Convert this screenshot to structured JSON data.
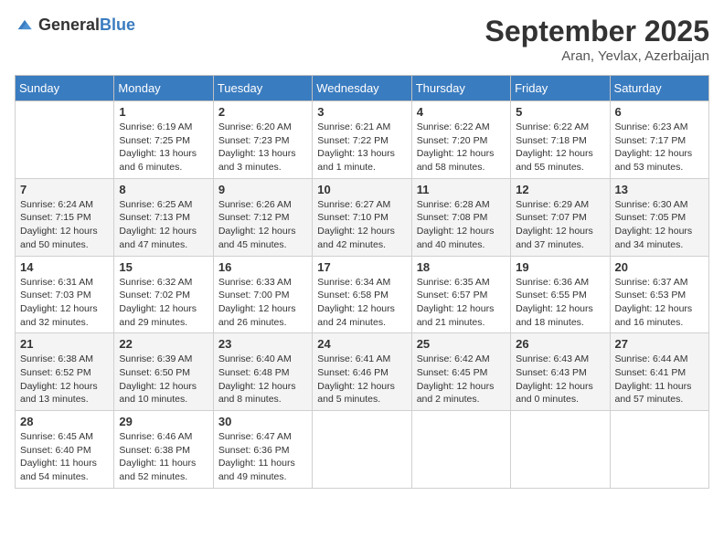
{
  "logo": {
    "general": "General",
    "blue": "Blue"
  },
  "header": {
    "month": "September 2025",
    "location": "Aran, Yevlax, Azerbaijan"
  },
  "weekdays": [
    "Sunday",
    "Monday",
    "Tuesday",
    "Wednesday",
    "Thursday",
    "Friday",
    "Saturday"
  ],
  "weeks": [
    [
      {
        "day": "",
        "text": ""
      },
      {
        "day": "1",
        "text": "Sunrise: 6:19 AM\nSunset: 7:25 PM\nDaylight: 13 hours\nand 6 minutes."
      },
      {
        "day": "2",
        "text": "Sunrise: 6:20 AM\nSunset: 7:23 PM\nDaylight: 13 hours\nand 3 minutes."
      },
      {
        "day": "3",
        "text": "Sunrise: 6:21 AM\nSunset: 7:22 PM\nDaylight: 13 hours\nand 1 minute."
      },
      {
        "day": "4",
        "text": "Sunrise: 6:22 AM\nSunset: 7:20 PM\nDaylight: 12 hours\nand 58 minutes."
      },
      {
        "day": "5",
        "text": "Sunrise: 6:22 AM\nSunset: 7:18 PM\nDaylight: 12 hours\nand 55 minutes."
      },
      {
        "day": "6",
        "text": "Sunrise: 6:23 AM\nSunset: 7:17 PM\nDaylight: 12 hours\nand 53 minutes."
      }
    ],
    [
      {
        "day": "7",
        "text": "Sunrise: 6:24 AM\nSunset: 7:15 PM\nDaylight: 12 hours\nand 50 minutes."
      },
      {
        "day": "8",
        "text": "Sunrise: 6:25 AM\nSunset: 7:13 PM\nDaylight: 12 hours\nand 47 minutes."
      },
      {
        "day": "9",
        "text": "Sunrise: 6:26 AM\nSunset: 7:12 PM\nDaylight: 12 hours\nand 45 minutes."
      },
      {
        "day": "10",
        "text": "Sunrise: 6:27 AM\nSunset: 7:10 PM\nDaylight: 12 hours\nand 42 minutes."
      },
      {
        "day": "11",
        "text": "Sunrise: 6:28 AM\nSunset: 7:08 PM\nDaylight: 12 hours\nand 40 minutes."
      },
      {
        "day": "12",
        "text": "Sunrise: 6:29 AM\nSunset: 7:07 PM\nDaylight: 12 hours\nand 37 minutes."
      },
      {
        "day": "13",
        "text": "Sunrise: 6:30 AM\nSunset: 7:05 PM\nDaylight: 12 hours\nand 34 minutes."
      }
    ],
    [
      {
        "day": "14",
        "text": "Sunrise: 6:31 AM\nSunset: 7:03 PM\nDaylight: 12 hours\nand 32 minutes."
      },
      {
        "day": "15",
        "text": "Sunrise: 6:32 AM\nSunset: 7:02 PM\nDaylight: 12 hours\nand 29 minutes."
      },
      {
        "day": "16",
        "text": "Sunrise: 6:33 AM\nSunset: 7:00 PM\nDaylight: 12 hours\nand 26 minutes."
      },
      {
        "day": "17",
        "text": "Sunrise: 6:34 AM\nSunset: 6:58 PM\nDaylight: 12 hours\nand 24 minutes."
      },
      {
        "day": "18",
        "text": "Sunrise: 6:35 AM\nSunset: 6:57 PM\nDaylight: 12 hours\nand 21 minutes."
      },
      {
        "day": "19",
        "text": "Sunrise: 6:36 AM\nSunset: 6:55 PM\nDaylight: 12 hours\nand 18 minutes."
      },
      {
        "day": "20",
        "text": "Sunrise: 6:37 AM\nSunset: 6:53 PM\nDaylight: 12 hours\nand 16 minutes."
      }
    ],
    [
      {
        "day": "21",
        "text": "Sunrise: 6:38 AM\nSunset: 6:52 PM\nDaylight: 12 hours\nand 13 minutes."
      },
      {
        "day": "22",
        "text": "Sunrise: 6:39 AM\nSunset: 6:50 PM\nDaylight: 12 hours\nand 10 minutes."
      },
      {
        "day": "23",
        "text": "Sunrise: 6:40 AM\nSunset: 6:48 PM\nDaylight: 12 hours\nand 8 minutes."
      },
      {
        "day": "24",
        "text": "Sunrise: 6:41 AM\nSunset: 6:46 PM\nDaylight: 12 hours\nand 5 minutes."
      },
      {
        "day": "25",
        "text": "Sunrise: 6:42 AM\nSunset: 6:45 PM\nDaylight: 12 hours\nand 2 minutes."
      },
      {
        "day": "26",
        "text": "Sunrise: 6:43 AM\nSunset: 6:43 PM\nDaylight: 12 hours\nand 0 minutes."
      },
      {
        "day": "27",
        "text": "Sunrise: 6:44 AM\nSunset: 6:41 PM\nDaylight: 11 hours\nand 57 minutes."
      }
    ],
    [
      {
        "day": "28",
        "text": "Sunrise: 6:45 AM\nSunset: 6:40 PM\nDaylight: 11 hours\nand 54 minutes."
      },
      {
        "day": "29",
        "text": "Sunrise: 6:46 AM\nSunset: 6:38 PM\nDaylight: 11 hours\nand 52 minutes."
      },
      {
        "day": "30",
        "text": "Sunrise: 6:47 AM\nSunset: 6:36 PM\nDaylight: 11 hours\nand 49 minutes."
      },
      {
        "day": "",
        "text": ""
      },
      {
        "day": "",
        "text": ""
      },
      {
        "day": "",
        "text": ""
      },
      {
        "day": "",
        "text": ""
      }
    ]
  ]
}
